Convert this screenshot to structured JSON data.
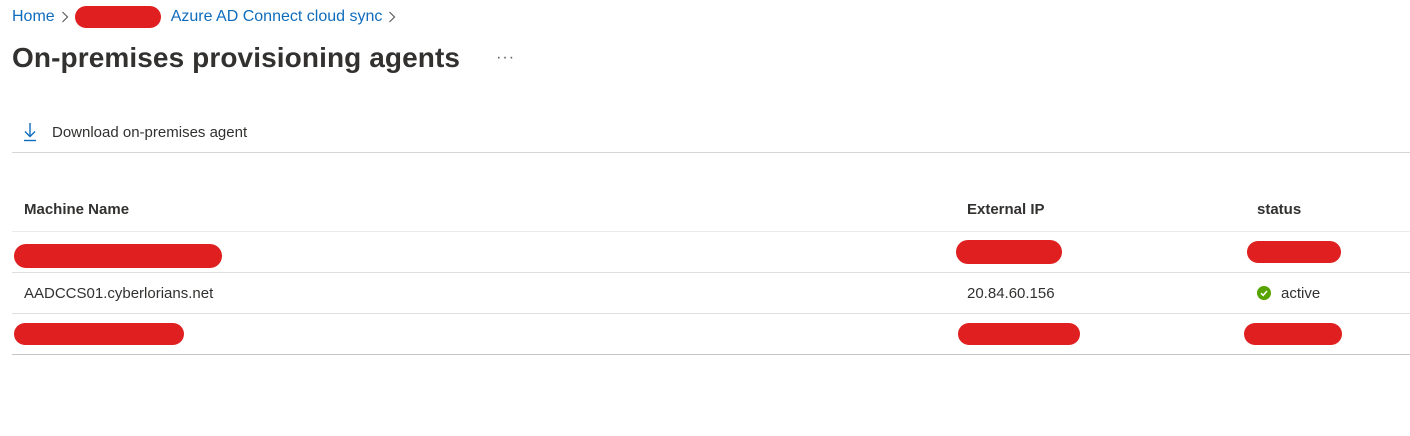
{
  "breadcrumb": {
    "home": "Home",
    "sync": "Azure AD Connect cloud sync"
  },
  "page": {
    "title": "On-premises provisioning agents",
    "more": "···"
  },
  "command_bar": {
    "download_label": "Download on-premises agent",
    "download_icon": "download-arrow-icon"
  },
  "table": {
    "columns": [
      "Machine Name",
      "External IP",
      "status"
    ],
    "rows": [
      {
        "name": "",
        "ip": "",
        "status": "",
        "redacted": true
      },
      {
        "name": "AADCCS01.cyberlorians.net",
        "ip": "20.84.60.156",
        "status": "active",
        "status_icon": "check-circle-icon",
        "redacted": false
      },
      {
        "name": "",
        "ip": "",
        "status": "",
        "redacted": true
      }
    ]
  },
  "colors": {
    "link": "#0f6cbd",
    "redaction": "#e02020",
    "active": "#57a300"
  }
}
